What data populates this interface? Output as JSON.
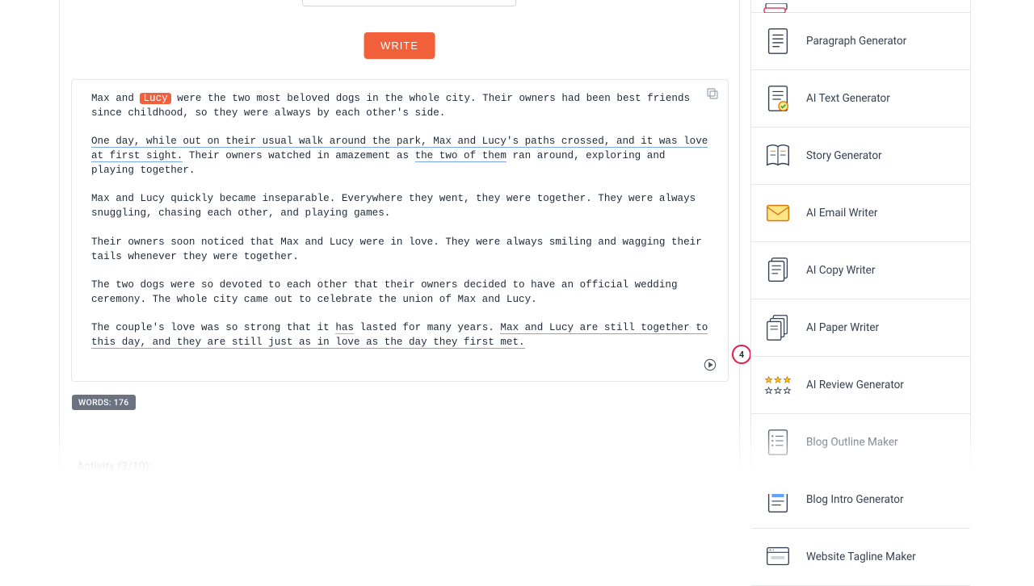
{
  "toolbar": {
    "write_label": "WRITE"
  },
  "output": {
    "p1_prefix": "Max and ",
    "p1_highlight": "Lucy",
    "p1_suffix": " were the two most beloved dogs in the whole city. Their owners had been best friends since childhood, so they were always by each other's side.",
    "p2_ul": "One day, while out on their usual walk around the park, Max and Lucy's paths crossed, and it was love at first sight.",
    "p2_mid": " Their owners watched in amazement as ",
    "p2_ul2": "the two of them",
    "p2_suffix": " ran around, exploring and playing together.",
    "p3": "Max and Lucy quickly became inseparable. Everywhere they went, they were together. They were always snuggling, chasing each other, and playing games.",
    "p4": "Their owners soon noticed that Max and Lucy were in love. They were always smiling and wagging their tails whenever they were together.",
    "p5": "The two dogs were so devoted to each other that their owners decided to have an official wedding ceremony. The whole city came out to celebrate the union of Max and Lucy.",
    "p6_prefix": "The couple's love was so strong that it ",
    "p6_has": "has",
    "p6_mid": " lasted for many years. ",
    "p6_ul": "Max and Lucy are still together to this day, and they are still just as in love as the day they first met."
  },
  "meta": {
    "word_count_label": "WORDS: 176",
    "activity_label": "Activity (3/10):",
    "suggestion_count": "4"
  },
  "tools": [
    {
      "label": "Paragraph Generator",
      "icon": "doc-lines"
    },
    {
      "label": "AI Text Generator",
      "icon": "doc-check"
    },
    {
      "label": "Story Generator",
      "icon": "book"
    },
    {
      "label": "AI Email Writer",
      "icon": "envelope"
    },
    {
      "label": "AI Copy Writer",
      "icon": "doc-stack"
    },
    {
      "label": "AI Paper Writer",
      "icon": "papers"
    },
    {
      "label": "AI Review Generator",
      "icon": "stars"
    },
    {
      "label": "Blog Outline Maker",
      "icon": "doc-list"
    },
    {
      "label": "Blog Intro Generator",
      "icon": "doc-intro"
    },
    {
      "label": "Website Tagline Maker",
      "icon": "browser"
    }
  ]
}
